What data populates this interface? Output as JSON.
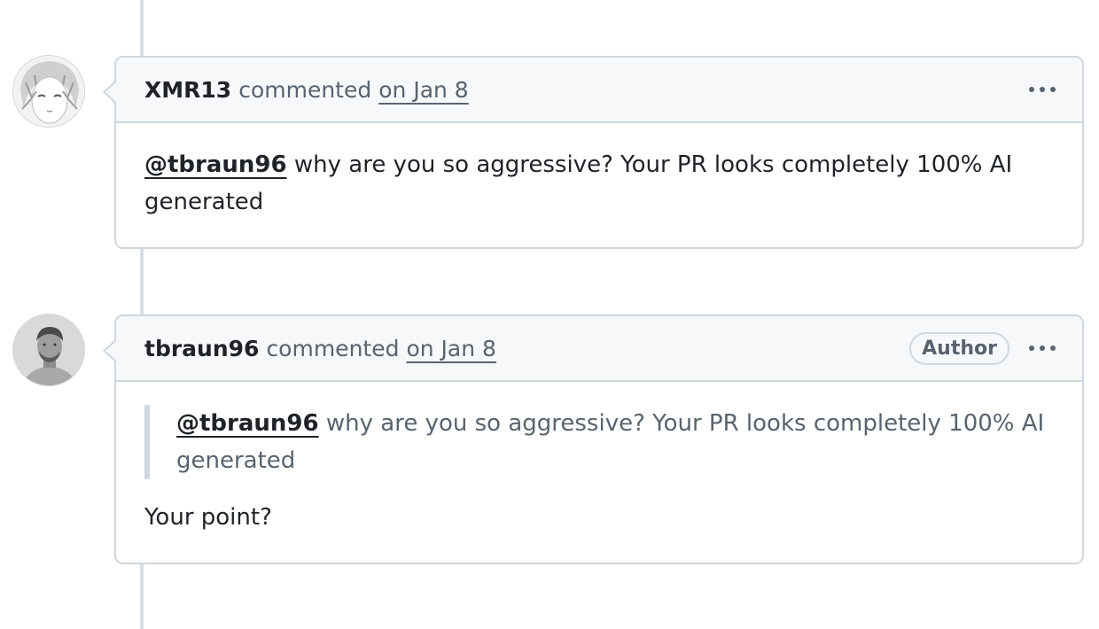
{
  "comments": [
    {
      "author": "XMR13",
      "action": "commented",
      "timestamp": "on Jan 8",
      "avatar_icon": "anime-avatar",
      "body": {
        "mention": "@tbraun96",
        "text": " why are you so aggressive? Your PR looks completely 100% AI generated"
      }
    },
    {
      "author": "tbraun96",
      "action": "commented",
      "timestamp": "on Jan 8",
      "badge": "Author",
      "avatar_icon": "person-photo-avatar",
      "quote": {
        "mention": "@tbraun96",
        "text": " why are you so aggressive? Your PR looks completely 100% AI generated"
      },
      "body": {
        "text": "Your point?"
      }
    }
  ],
  "icons": {
    "more": "kebab-horizontal-icon"
  },
  "colors": {
    "border": "#d0d7de",
    "header_bg": "#f6f8fa",
    "muted_text": "#59636e",
    "text": "#1f2328",
    "timeline": "#d8dee4"
  }
}
